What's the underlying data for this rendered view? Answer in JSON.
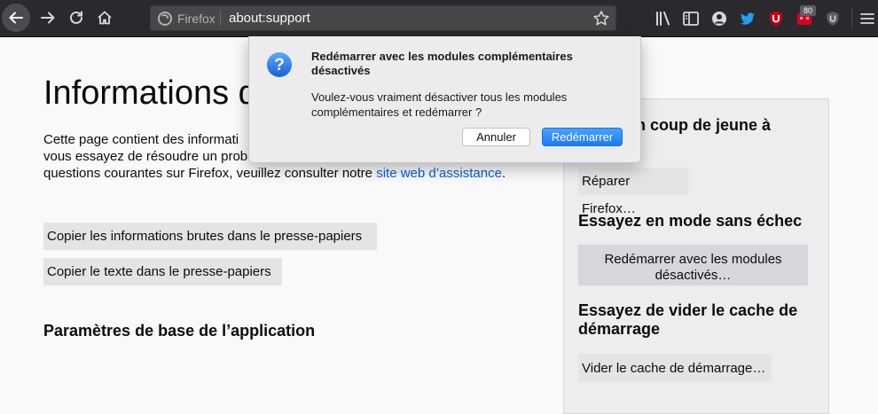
{
  "toolbar": {
    "identity_label": "Firefox",
    "url": "about:support",
    "notification_count": "80"
  },
  "page": {
    "title": "Informations de",
    "intro_line1": "Cette page contient des informati",
    "intro_line2": "vous essayez de résoudre un prob",
    "intro_line3": "questions courantes sur Firefox, veuillez consulter notre ",
    "intro_link": "site web d’assistance",
    "intro_end": ".",
    "copy_raw_button": "Copier les informations brutes dans le presse-papiers",
    "copy_text_button": "Copier le texte dans le presse-papiers",
    "section_heading": "Paramètres de base de l’application"
  },
  "sidebar": {
    "refresh_heading": "un coup de jeune à",
    "refresh_button": "Réparer Firefox…",
    "safe_mode_heading": "Essayez en mode sans échec",
    "safe_mode_button_line1": "Redémarrer avec les modules",
    "safe_mode_button_line2": "désactivés…",
    "cache_heading_line1": "Essayez de vider le cache de",
    "cache_heading_line2": "démarrage",
    "cache_button": "Vider le cache de démarrage…"
  },
  "dialog": {
    "title": "Redémarrer avec les modules complémentaires désactivés",
    "message": "Voulez-vous vraiment désactiver tous les modules complémentaires et redémarrer ?",
    "cancel_label": "Annuler",
    "confirm_label": "Redémarrer"
  },
  "colors": {
    "toolbar_bg": "#2a2a2e",
    "link": "#0060df",
    "dialog_default_button": "#1a7af5",
    "twitter_blue": "#1da1f2",
    "ublock_red": "#c20017"
  },
  "icons": [
    "back-icon",
    "forward-icon",
    "reload-icon",
    "home-icon",
    "firefox-logo-icon",
    "bookmark-star-icon",
    "library-icon",
    "sidebar-icon",
    "account-icon",
    "twitter-icon",
    "ublock-origin-icon",
    "notification-icon",
    "ublock-icon",
    "menu-icon",
    "question-icon"
  ]
}
